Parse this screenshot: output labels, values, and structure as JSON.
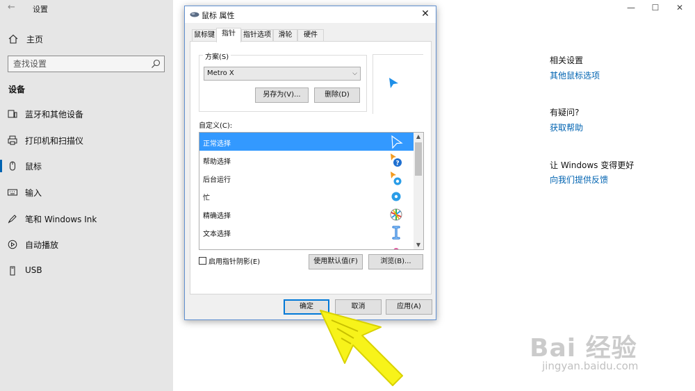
{
  "app": {
    "title": "设置"
  },
  "window_controls": {
    "minimize": "—",
    "maximize": "☐",
    "close": "✕"
  },
  "sidebar": {
    "home_label": "主页",
    "search": {
      "placeholder": "查找设置"
    },
    "section_title": "设备",
    "items": [
      {
        "label": "蓝牙和其他设备",
        "icon": "bluetooth-devices-icon"
      },
      {
        "label": "打印机和扫描仪",
        "icon": "printer-icon"
      },
      {
        "label": "鼠标",
        "icon": "mouse-icon",
        "active": true
      },
      {
        "label": "输入",
        "icon": "keyboard-icon"
      },
      {
        "label": "笔和 Windows Ink",
        "icon": "pen-icon"
      },
      {
        "label": "自动播放",
        "icon": "autoplay-icon"
      },
      {
        "label": "USB",
        "icon": "usb-icon"
      }
    ]
  },
  "related": {
    "heading": "相关设置",
    "link": "其他鼠标选项",
    "help_heading": "有疑问?",
    "help_link": "获取帮助",
    "feedback_heading": "让 Windows 变得更好",
    "feedback_link": "向我们提供反馈"
  },
  "dialog": {
    "title": "鼠标 属性",
    "close": "✕",
    "tabs": [
      "鼠标键",
      "指针",
      "指针选项",
      "滑轮",
      "硬件"
    ],
    "active_tab": "指针",
    "scheme": {
      "label": "方案(S)",
      "selected": "Metro X",
      "save_as": "另存为(V)...",
      "delete": "删除(D)"
    },
    "customize_label": "自定义(C):",
    "cursors": [
      {
        "name": "正常选择",
        "icon": "arrow-cursor-icon",
        "selected": true
      },
      {
        "name": "帮助选择",
        "icon": "help-cursor-icon"
      },
      {
        "name": "后台运行",
        "icon": "working-in-background-cursor-icon"
      },
      {
        "name": "忙",
        "icon": "busy-cursor-icon"
      },
      {
        "name": "精确选择",
        "icon": "precision-cursor-icon"
      },
      {
        "name": "文本选择",
        "icon": "text-cursor-icon"
      }
    ],
    "shadow_checkbox": {
      "label": "启用指针阴影(E)",
      "checked": false
    },
    "use_default": "使用默认值(F)",
    "browse": "浏览(B)...",
    "ok": "确定",
    "cancel": "取消",
    "apply": "应用(A)"
  },
  "watermark": {
    "logo": "Bai 经验",
    "url": "jingyan.baidu.com"
  },
  "colors": {
    "accent": "#0063b1",
    "selection": "#3399ff",
    "cursor_blue": "#1e8fe8",
    "annotation": "#f7f31a"
  }
}
